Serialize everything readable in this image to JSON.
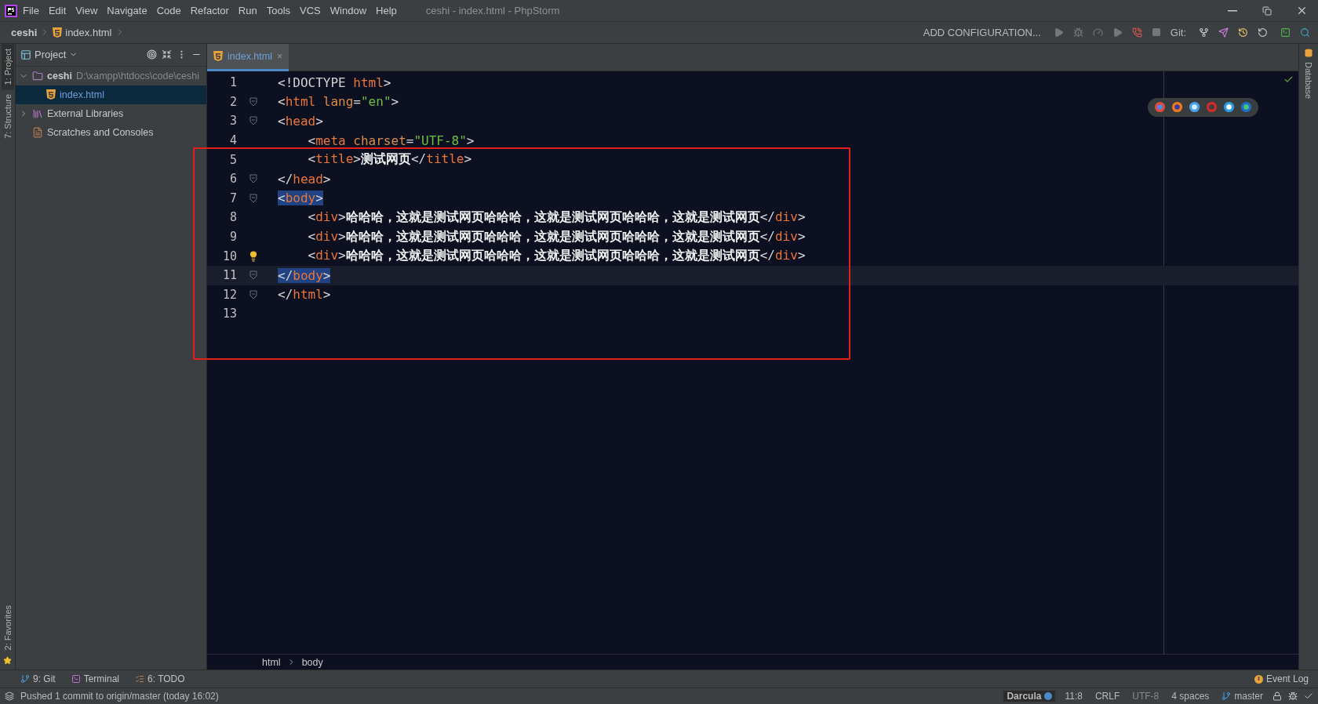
{
  "title_bar": {
    "menu": [
      "File",
      "Edit",
      "View",
      "Navigate",
      "Code",
      "Refactor",
      "Run",
      "Tools",
      "VCS",
      "Window",
      "Help"
    ],
    "title": "ceshi - index.html - PhpStorm"
  },
  "nav_bar": {
    "crumbs": [
      {
        "label": "ceshi",
        "kind": "project"
      },
      {
        "label": "index.html",
        "kind": "html"
      }
    ],
    "run_config": "ADD CONFIGURATION...",
    "git_label": "Git:"
  },
  "left_strip": {
    "top": [
      {
        "label": "1: Project",
        "selected": true
      },
      {
        "label": "7: Structure",
        "selected": false
      }
    ],
    "bottom": [
      {
        "label": "2: Favorites",
        "selected": false
      }
    ]
  },
  "project_panel": {
    "title": "Project",
    "tree": [
      {
        "label": "ceshi",
        "path": "D:\\xampp\\htdocs\\code\\ceshi",
        "kind": "folder",
        "expanded": true,
        "selected": false,
        "children": [
          {
            "label": "index.html",
            "kind": "html",
            "selected": true
          }
        ]
      },
      {
        "label": "External Libraries",
        "kind": "library",
        "expanded": false,
        "selected": false
      },
      {
        "label": "Scratches and Consoles",
        "kind": "scratches",
        "selected": false
      }
    ]
  },
  "editor": {
    "tabs": [
      {
        "label": "index.html",
        "selected": true,
        "close": "×"
      }
    ],
    "lines": [
      {
        "number": "1",
        "fold": false,
        "current": false,
        "selected": false,
        "hint": false,
        "tokens": [
          {
            "kind": "bracket",
            "text": "<!DOCTYPE "
          },
          {
            "kind": "tag",
            "text": "html"
          },
          {
            "kind": "bracket",
            "text": ">"
          }
        ]
      },
      {
        "number": "2",
        "fold": true,
        "current": false,
        "selected": false,
        "hint": false,
        "tokens": [
          {
            "kind": "bracket",
            "text": "<"
          },
          {
            "kind": "tag",
            "text": "html"
          },
          {
            "kind": "attr",
            "text": " lang"
          },
          {
            "kind": "bracket",
            "text": "="
          },
          {
            "kind": "value",
            "text": "\"en\""
          },
          {
            "kind": "bracket",
            "text": ">"
          }
        ]
      },
      {
        "number": "3",
        "fold": true,
        "current": false,
        "selected": false,
        "hint": false,
        "tokens": [
          {
            "kind": "bracket",
            "text": "<"
          },
          {
            "kind": "tag",
            "text": "head"
          },
          {
            "kind": "bracket",
            "text": ">"
          }
        ]
      },
      {
        "number": "4",
        "fold": false,
        "current": false,
        "selected": false,
        "hint": false,
        "tokens": [
          {
            "kind": "bracket",
            "text": "    <"
          },
          {
            "kind": "tag",
            "text": "meta"
          },
          {
            "kind": "attr",
            "text": " charset"
          },
          {
            "kind": "bracket",
            "text": "="
          },
          {
            "kind": "value",
            "text": "\"UTF-8\""
          },
          {
            "kind": "bracket",
            "text": ">"
          }
        ]
      },
      {
        "number": "5",
        "fold": false,
        "current": false,
        "selected": false,
        "hint": false,
        "tokens": [
          {
            "kind": "bracket",
            "text": "    <"
          },
          {
            "kind": "tag",
            "text": "title"
          },
          {
            "kind": "bracket",
            "text": ">"
          },
          {
            "kind": "text",
            "text": "测试网页"
          },
          {
            "kind": "bracket",
            "text": "</"
          },
          {
            "kind": "tag",
            "text": "title"
          },
          {
            "kind": "bracket",
            "text": ">"
          }
        ]
      },
      {
        "number": "6",
        "fold": true,
        "current": false,
        "selected": false,
        "hint": false,
        "tokens": [
          {
            "kind": "bracket",
            "text": "</"
          },
          {
            "kind": "tag",
            "text": "head"
          },
          {
            "kind": "bracket",
            "text": ">"
          }
        ]
      },
      {
        "number": "7",
        "fold": true,
        "current": false,
        "selected": true,
        "hint": false,
        "tokens": [
          {
            "kind": "bracket",
            "text": "<"
          },
          {
            "kind": "tag",
            "text": "body"
          },
          {
            "kind": "bracket",
            "text": ">"
          }
        ]
      },
      {
        "number": "8",
        "fold": false,
        "current": false,
        "selected": false,
        "hint": false,
        "tokens": [
          {
            "kind": "bracket",
            "text": "    <"
          },
          {
            "kind": "tag",
            "text": "div"
          },
          {
            "kind": "bracket",
            "text": ">"
          },
          {
            "kind": "text",
            "text": "哈哈哈，这就是测试网页哈哈哈，这就是测试网页哈哈哈，这就是测试网页"
          },
          {
            "kind": "bracket",
            "text": "</"
          },
          {
            "kind": "tag",
            "text": "div"
          },
          {
            "kind": "bracket",
            "text": ">"
          }
        ]
      },
      {
        "number": "9",
        "fold": false,
        "current": false,
        "selected": false,
        "hint": false,
        "tokens": [
          {
            "kind": "bracket",
            "text": "    <"
          },
          {
            "kind": "tag",
            "text": "div"
          },
          {
            "kind": "bracket",
            "text": ">"
          },
          {
            "kind": "text",
            "text": "哈哈哈，这就是测试网页哈哈哈，这就是测试网页哈哈哈，这就是测试网页"
          },
          {
            "kind": "bracket",
            "text": "</"
          },
          {
            "kind": "tag",
            "text": "div"
          },
          {
            "kind": "bracket",
            "text": ">"
          }
        ]
      },
      {
        "number": "10",
        "fold": false,
        "current": false,
        "selected": false,
        "hint": true,
        "tokens": [
          {
            "kind": "bracket",
            "text": "    <"
          },
          {
            "kind": "tag",
            "text": "div"
          },
          {
            "kind": "bracket",
            "text": ">"
          },
          {
            "kind": "text",
            "text": "哈哈哈，这就是测试网页哈哈哈，这就是测试网页哈哈哈，这就是测试网页"
          },
          {
            "kind": "bracket",
            "text": "</"
          },
          {
            "kind": "tag",
            "text": "div"
          },
          {
            "kind": "bracket",
            "text": ">"
          }
        ]
      },
      {
        "number": "11",
        "fold": true,
        "current": true,
        "selected": true,
        "hint": false,
        "tokens": [
          {
            "kind": "bracket",
            "text": "</"
          },
          {
            "kind": "tag",
            "text": "body"
          },
          {
            "kind": "bracket",
            "text": ">"
          }
        ]
      },
      {
        "number": "12",
        "fold": true,
        "current": false,
        "selected": false,
        "hint": false,
        "tokens": [
          {
            "kind": "bracket",
            "text": "</"
          },
          {
            "kind": "tag",
            "text": "html"
          },
          {
            "kind": "bracket",
            "text": ">"
          }
        ]
      },
      {
        "number": "13",
        "fold": false,
        "current": false,
        "hint": false
      }
    ],
    "breadcrumbs": [
      "html",
      "body"
    ]
  },
  "right_strip": [
    "Database"
  ],
  "tool_windows": [
    {
      "label": "9: Git",
      "kind": "git"
    },
    {
      "label": "Terminal",
      "kind": "terminal"
    },
    {
      "label": "6: TODO",
      "kind": "todo"
    }
  ],
  "event_log": "Event Log",
  "status_bar": {
    "message": "Pushed 1 commit to origin/master (today 16:02)",
    "theme": "Darcula",
    "position": "11:8",
    "line_ending": "CRLF",
    "encoding": "UTF-8",
    "indent": "4 spaces",
    "branch": "master"
  }
}
